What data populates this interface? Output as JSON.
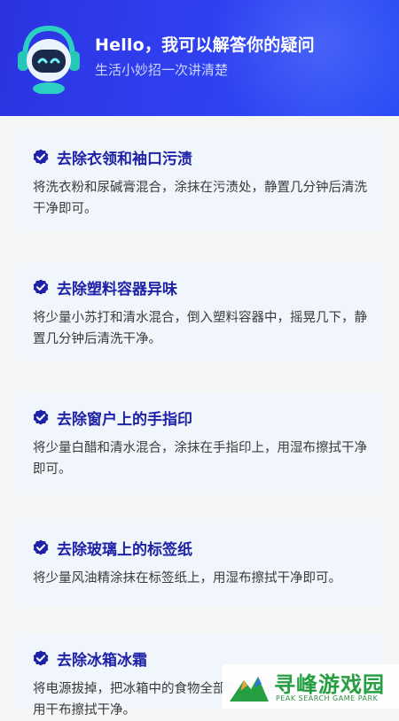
{
  "header": {
    "title": "Hello，我可以解答你的疑问",
    "subtitle": "生活小妙招一次讲清楚"
  },
  "tips": [
    {
      "title": "去除衣领和袖口污渍",
      "desc": "将洗衣粉和尿碱膏混合，涂抹在污渍处，静置几分钟后清洗干净即可。"
    },
    {
      "title": "去除塑料容器异味",
      "desc": "将少量小苏打和清水混合，倒入塑料容器中，摇晃几下，静置几分钟后清洗干净。"
    },
    {
      "title": "去除窗户上的手指印",
      "desc": "将少量白醋和清水混合，涂抹在手指印上，用湿布擦拭干净即可。"
    },
    {
      "title": "去除玻璃上的标签纸",
      "desc": "将少量风油精涂抹在标签纸上，用湿布擦拭干净即可。"
    },
    {
      "title": "去除冰箱冰霜",
      "desc": "将电源拔掉，把冰箱中的食物全部取出，等待冰霜吹化，再用干布擦拭干净。"
    }
  ],
  "watermark": {
    "name": "寻峰游戏园",
    "sub": "PEAK SEARCH GAME PARK"
  },
  "colors": {
    "header_blue": "#2f3ff0",
    "title_blue": "#1d22a6",
    "card_bg": "#f1f5fc",
    "robot_teal": "#35d8c8"
  },
  "icons": {
    "header": "robot-mascot-icon",
    "tip": "check-circle-icon"
  }
}
